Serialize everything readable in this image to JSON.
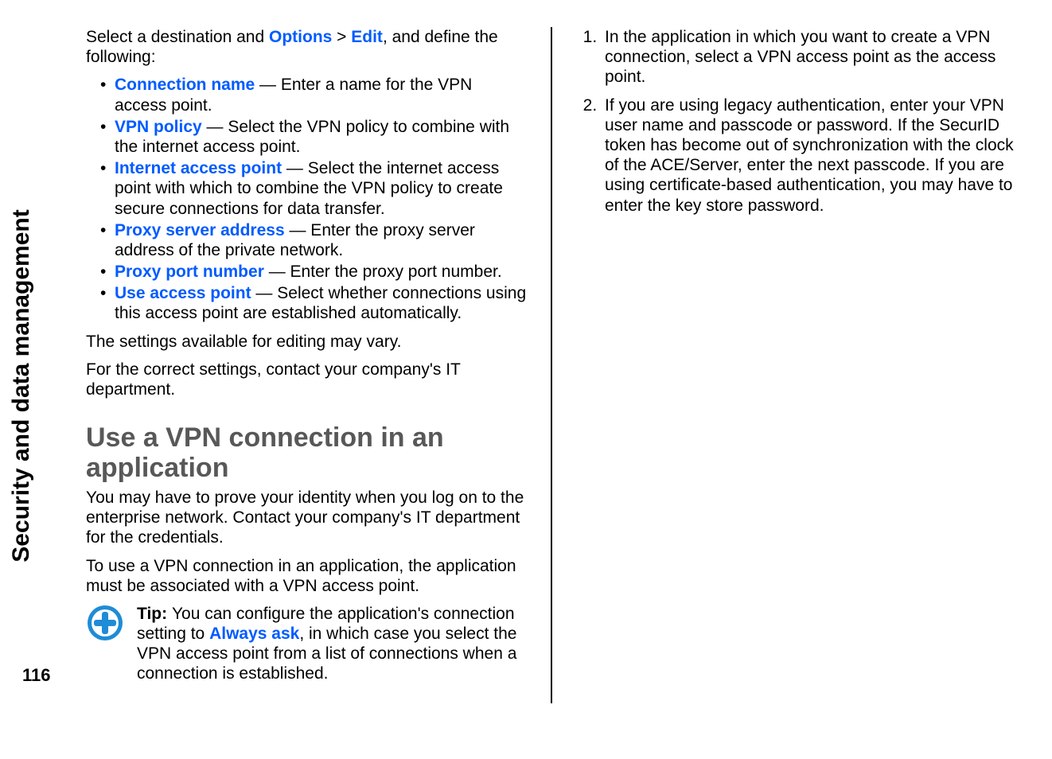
{
  "sidebar": {
    "label": "Security and data management"
  },
  "pageNumber": "116",
  "intro": {
    "pre": "Select a destination and ",
    "opt": "Options",
    "gt": " > ",
    "edit": "Edit",
    "post": ", and define the following:"
  },
  "bullets": [
    {
      "term": "Connection name",
      "desc": " — Enter a name for the VPN access point."
    },
    {
      "term": "VPN policy",
      "desc": " — Select the VPN policy to combine with the internet access point."
    },
    {
      "term": "Internet access point",
      "desc": " — Select the internet access point with which to combine the VPN policy to create secure connections for data transfer."
    },
    {
      "term": "Proxy server address",
      "desc": " — Enter the proxy server address of the private network."
    },
    {
      "term": "Proxy port number",
      "desc": " — Enter the proxy port number."
    },
    {
      "term": "Use access point",
      "desc": " — Select whether connections using this access point are established automatically."
    }
  ],
  "afterBullets1": "The settings available for editing may vary.",
  "afterBullets2": "For the correct settings, contact your company's IT department.",
  "heading": "Use a VPN connection in an application",
  "para1": "You may have to prove your identity when you log on to the enterprise network. Contact your company's IT department for the credentials.",
  "para2": "To use a VPN connection in an application, the application must be associated with a VPN access point.",
  "tip": {
    "label": "Tip: ",
    "pre": "You can configure the application's connection setting to ",
    "always": "Always ask",
    "post": ", in which case you select the VPN access point from a list of connections when a connection is established."
  },
  "steps": [
    "In the application in which you want to create a VPN connection, select a VPN access point as the access point.",
    "If you are using legacy authentication, enter your VPN user name and passcode or password. If the SecurID token has become out of synchronization with the clock of the ACE/Server, enter the next passcode. If you are using certificate-based authentication, you may have to enter the key store password."
  ]
}
